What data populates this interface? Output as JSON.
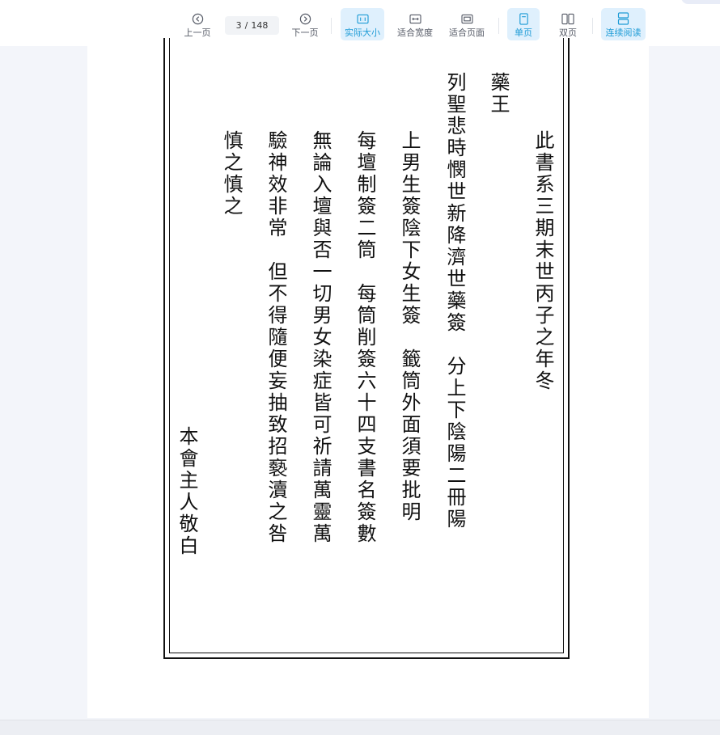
{
  "toolbar": {
    "prev_label": "上一页",
    "page_current": "3",
    "page_separator": "/",
    "page_total": "148",
    "next_label": "下一页",
    "actual_size_label": "实际大小",
    "fit_width_label": "适合宽度",
    "fit_page_label": "适合页面",
    "single_page_label": "单页",
    "double_page_label": "双页",
    "continuous_label": "连续阅读",
    "accent_color": "#1d9bd6"
  },
  "document": {
    "columns": [
      "此書系三期末世丙子之年冬",
      "藥王",
      "列聖悲時憫世新降濟世藥簽　分上下陰陽二冊陽",
      "上男生簽陰下女生簽　籤筒外面須要批明",
      "每壇制簽二筒　每筒削簽六十四支書名簽數",
      "無論入壇與否一切男女染症皆可祈請萬靈萬",
      "驗神效非常　但不得隨便妄抽致招褻瀆之咎",
      "慎之慎之",
      "本會主人敬白"
    ]
  }
}
